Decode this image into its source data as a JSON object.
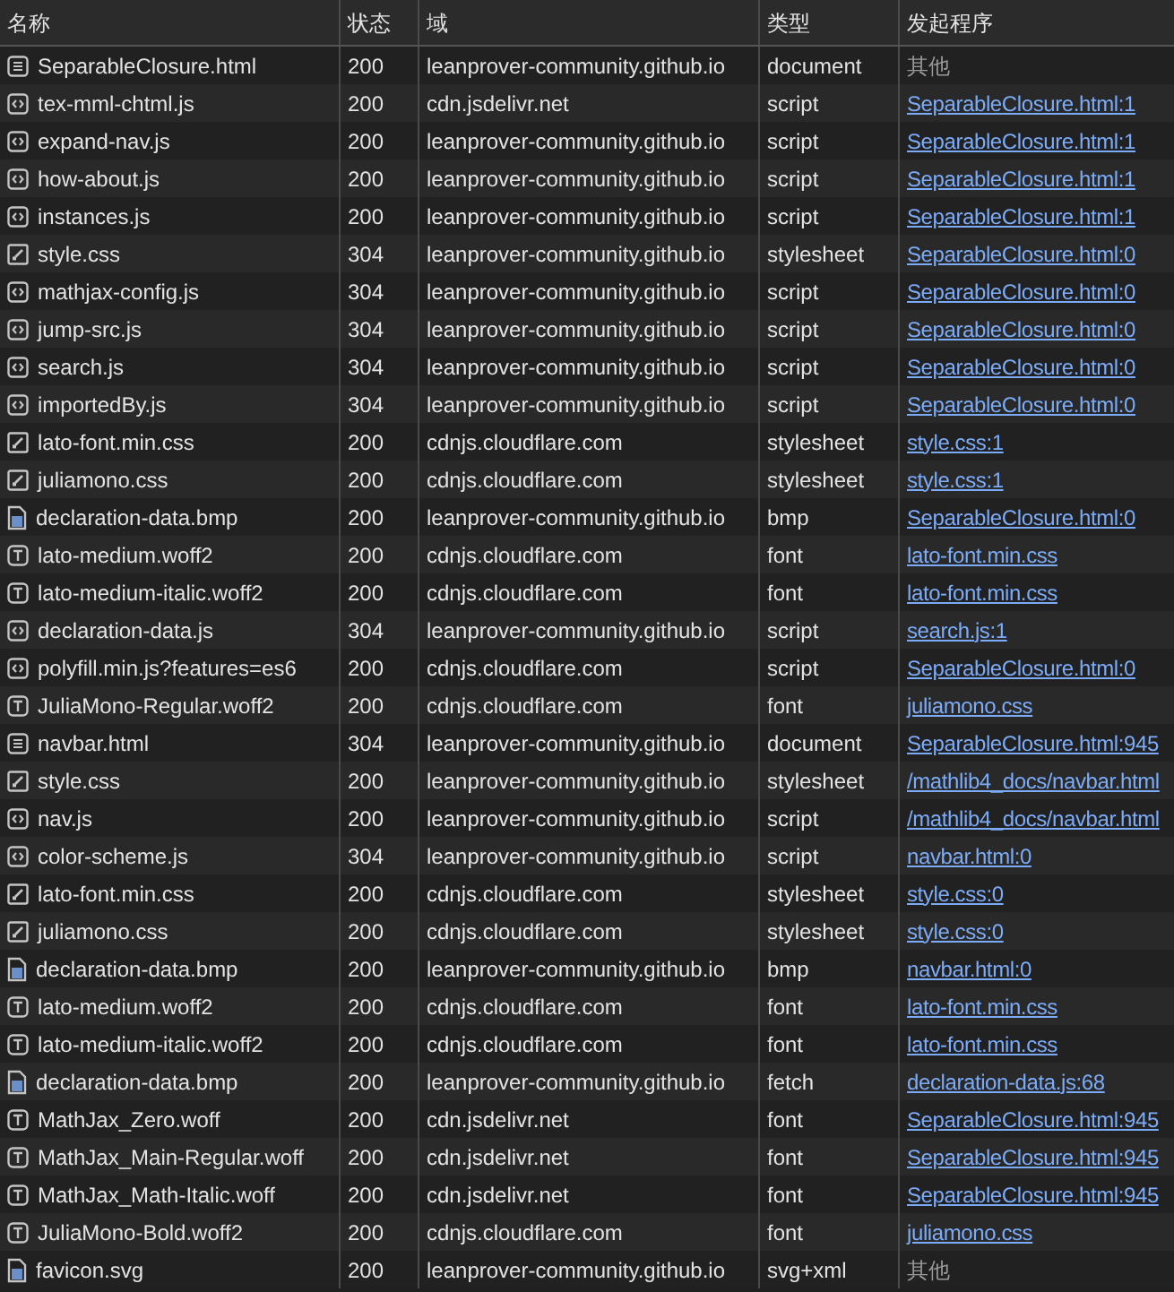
{
  "table": {
    "columns": [
      "名称",
      "状态",
      "域",
      "类型",
      "发起程序"
    ],
    "rows": [
      {
        "kind": "doc",
        "name": "SeparableClosure.html",
        "status": "200",
        "domain": "leanprover-community.github.io",
        "type": "document",
        "initiator": {
          "kind": "plain",
          "text": "其他"
        }
      },
      {
        "kind": "code",
        "name": "tex-mml-chtml.js",
        "status": "200",
        "domain": "cdn.jsdelivr.net",
        "type": "script",
        "initiator": {
          "kind": "link",
          "text": "SeparableClosure.html:1"
        }
      },
      {
        "kind": "code",
        "name": "expand-nav.js",
        "status": "200",
        "domain": "leanprover-community.github.io",
        "type": "script",
        "initiator": {
          "kind": "link",
          "text": "SeparableClosure.html:1"
        }
      },
      {
        "kind": "code",
        "name": "how-about.js",
        "status": "200",
        "domain": "leanprover-community.github.io",
        "type": "script",
        "initiator": {
          "kind": "link",
          "text": "SeparableClosure.html:1"
        }
      },
      {
        "kind": "code",
        "name": "instances.js",
        "status": "200",
        "domain": "leanprover-community.github.io",
        "type": "script",
        "initiator": {
          "kind": "link",
          "text": "SeparableClosure.html:1"
        }
      },
      {
        "kind": "style",
        "name": "style.css",
        "status": "304",
        "domain": "leanprover-community.github.io",
        "type": "stylesheet",
        "initiator": {
          "kind": "link",
          "text": "SeparableClosure.html:0"
        }
      },
      {
        "kind": "code",
        "name": "mathjax-config.js",
        "status": "304",
        "domain": "leanprover-community.github.io",
        "type": "script",
        "initiator": {
          "kind": "link",
          "text": "SeparableClosure.html:0"
        }
      },
      {
        "kind": "code",
        "name": "jump-src.js",
        "status": "304",
        "domain": "leanprover-community.github.io",
        "type": "script",
        "initiator": {
          "kind": "link",
          "text": "SeparableClosure.html:0"
        }
      },
      {
        "kind": "code",
        "name": "search.js",
        "status": "304",
        "domain": "leanprover-community.github.io",
        "type": "script",
        "initiator": {
          "kind": "link",
          "text": "SeparableClosure.html:0"
        }
      },
      {
        "kind": "code",
        "name": "importedBy.js",
        "status": "304",
        "domain": "leanprover-community.github.io",
        "type": "script",
        "initiator": {
          "kind": "link",
          "text": "SeparableClosure.html:0"
        }
      },
      {
        "kind": "style",
        "name": "lato-font.min.css",
        "status": "200",
        "domain": "cdnjs.cloudflare.com",
        "type": "stylesheet",
        "initiator": {
          "kind": "link",
          "text": "style.css:1"
        }
      },
      {
        "kind": "style",
        "name": "juliamono.css",
        "status": "200",
        "domain": "cdnjs.cloudflare.com",
        "type": "stylesheet",
        "initiator": {
          "kind": "link",
          "text": "style.css:1"
        }
      },
      {
        "kind": "file",
        "name": "declaration-data.bmp",
        "status": "200",
        "domain": "leanprover-community.github.io",
        "type": "bmp",
        "initiator": {
          "kind": "link",
          "text": "SeparableClosure.html:0"
        }
      },
      {
        "kind": "font",
        "name": "lato-medium.woff2",
        "status": "200",
        "domain": "cdnjs.cloudflare.com",
        "type": "font",
        "initiator": {
          "kind": "link",
          "text": "lato-font.min.css"
        }
      },
      {
        "kind": "font",
        "name": "lato-medium-italic.woff2",
        "status": "200",
        "domain": "cdnjs.cloudflare.com",
        "type": "font",
        "initiator": {
          "kind": "link",
          "text": "lato-font.min.css"
        }
      },
      {
        "kind": "code",
        "name": "declaration-data.js",
        "status": "304",
        "domain": "leanprover-community.github.io",
        "type": "script",
        "initiator": {
          "kind": "link",
          "text": "search.js:1"
        }
      },
      {
        "kind": "code",
        "name": "polyfill.min.js?features=es6",
        "status": "200",
        "domain": "cdnjs.cloudflare.com",
        "type": "script",
        "initiator": {
          "kind": "link",
          "text": "SeparableClosure.html:0"
        }
      },
      {
        "kind": "font",
        "name": "JuliaMono-Regular.woff2",
        "status": "200",
        "domain": "cdnjs.cloudflare.com",
        "type": "font",
        "initiator": {
          "kind": "link",
          "text": "juliamono.css"
        }
      },
      {
        "kind": "doc",
        "name": "navbar.html",
        "status": "304",
        "domain": "leanprover-community.github.io",
        "type": "document",
        "initiator": {
          "kind": "link",
          "text": "SeparableClosure.html:945"
        }
      },
      {
        "kind": "style",
        "name": "style.css",
        "status": "200",
        "domain": "leanprover-community.github.io",
        "type": "stylesheet",
        "initiator": {
          "kind": "link",
          "text": "/mathlib4_docs/navbar.html"
        }
      },
      {
        "kind": "code",
        "name": "nav.js",
        "status": "200",
        "domain": "leanprover-community.github.io",
        "type": "script",
        "initiator": {
          "kind": "link",
          "text": "/mathlib4_docs/navbar.html"
        }
      },
      {
        "kind": "code",
        "name": "color-scheme.js",
        "status": "304",
        "domain": "leanprover-community.github.io",
        "type": "script",
        "initiator": {
          "kind": "link",
          "text": "navbar.html:0"
        }
      },
      {
        "kind": "style",
        "name": "lato-font.min.css",
        "status": "200",
        "domain": "cdnjs.cloudflare.com",
        "type": "stylesheet",
        "initiator": {
          "kind": "link",
          "text": "style.css:0"
        }
      },
      {
        "kind": "style",
        "name": "juliamono.css",
        "status": "200",
        "domain": "cdnjs.cloudflare.com",
        "type": "stylesheet",
        "initiator": {
          "kind": "link",
          "text": "style.css:0"
        }
      },
      {
        "kind": "file",
        "name": "declaration-data.bmp",
        "status": "200",
        "domain": "leanprover-community.github.io",
        "type": "bmp",
        "initiator": {
          "kind": "link",
          "text": "navbar.html:0"
        }
      },
      {
        "kind": "font",
        "name": "lato-medium.woff2",
        "status": "200",
        "domain": "cdnjs.cloudflare.com",
        "type": "font",
        "initiator": {
          "kind": "link",
          "text": "lato-font.min.css"
        }
      },
      {
        "kind": "font",
        "name": "lato-medium-italic.woff2",
        "status": "200",
        "domain": "cdnjs.cloudflare.com",
        "type": "font",
        "initiator": {
          "kind": "link",
          "text": "lato-font.min.css"
        }
      },
      {
        "kind": "file",
        "name": "declaration-data.bmp",
        "status": "200",
        "domain": "leanprover-community.github.io",
        "type": "fetch",
        "initiator": {
          "kind": "link",
          "text": "declaration-data.js:68"
        }
      },
      {
        "kind": "font",
        "name": "MathJax_Zero.woff",
        "status": "200",
        "domain": "cdn.jsdelivr.net",
        "type": "font",
        "initiator": {
          "kind": "link",
          "text": "SeparableClosure.html:945"
        }
      },
      {
        "kind": "font",
        "name": "MathJax_Main-Regular.woff",
        "status": "200",
        "domain": "cdn.jsdelivr.net",
        "type": "font",
        "initiator": {
          "kind": "link",
          "text": "SeparableClosure.html:945"
        }
      },
      {
        "kind": "font",
        "name": "MathJax_Math-Italic.woff",
        "status": "200",
        "domain": "cdn.jsdelivr.net",
        "type": "font",
        "initiator": {
          "kind": "link",
          "text": "SeparableClosure.html:945"
        }
      },
      {
        "kind": "font",
        "name": "JuliaMono-Bold.woff2",
        "status": "200",
        "domain": "cdnjs.cloudflare.com",
        "type": "font",
        "initiator": {
          "kind": "link",
          "text": "juliamono.css"
        }
      },
      {
        "kind": "file",
        "name": "favicon.svg",
        "status": "200",
        "domain": "leanprover-community.github.io",
        "type": "svg+xml",
        "initiator": {
          "kind": "plain",
          "text": "其他"
        }
      }
    ]
  }
}
